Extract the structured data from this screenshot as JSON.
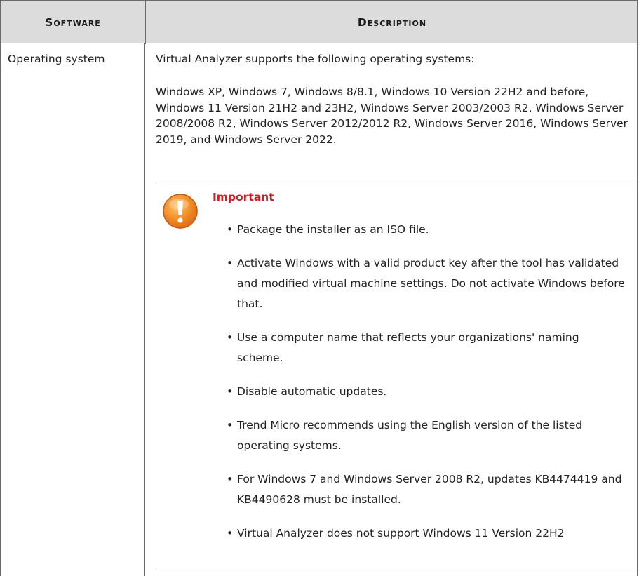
{
  "table": {
    "headers": {
      "software": "Software",
      "description": "Description"
    },
    "row": {
      "software": "Operating system",
      "intro": "Virtual Analyzer supports the following operating systems:",
      "os_list": "Windows XP, Windows 7, Windows 8/8.1, Windows 10 Version 22H2 and before, Windows 11 Version 21H2 and 23H2, Windows Server 2003/2003 R2, Windows Server 2008/2008 R2, Windows Server 2012/2012 R2, Windows Server 2016, Windows Server 2019, and Windows Server 2022."
    }
  },
  "important": {
    "icon": "warning-icon",
    "title": "Important",
    "accent_color": "#d71921",
    "icon_color": "#f08a24",
    "items": [
      "Package the installer as an ISO file.",
      "Activate Windows with a valid product key after the tool has validated and modified virtual machine settings. Do not activate Windows before that.",
      "Use a computer name that reflects your organizations' naming scheme.",
      "Disable automatic updates.",
      "Trend Micro recommends using the English version of the listed operating systems.",
      "For Windows 7 and Windows Server 2008 R2, updates KB4474419 and KB4490628 must be installed.",
      "Virtual Analyzer does not support Windows 11 Version 22H2"
    ]
  }
}
